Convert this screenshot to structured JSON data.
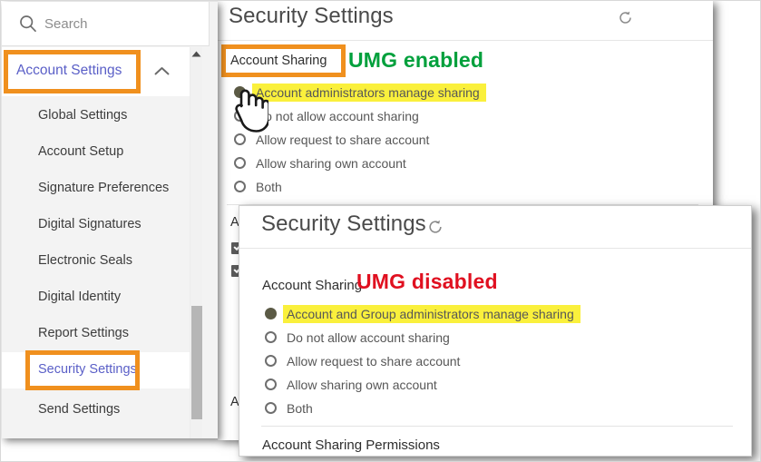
{
  "sidebar": {
    "search": {
      "placeholder": "Search",
      "icon": "search-icon"
    },
    "group": {
      "label": "Account Settings",
      "collapse_icon": "chevron-up-icon",
      "highlighted": true
    },
    "items": [
      {
        "label": "Global Settings",
        "active": false
      },
      {
        "label": "Account Setup",
        "active": false
      },
      {
        "label": "Signature Preferences",
        "active": false
      },
      {
        "label": "Digital Signatures",
        "active": false
      },
      {
        "label": "Electronic Seals",
        "active": false
      },
      {
        "label": "Digital Identity",
        "active": false
      },
      {
        "label": "Report Settings",
        "active": false
      },
      {
        "label": "Security Settings",
        "active": true
      },
      {
        "label": "Send Settings",
        "active": false
      }
    ],
    "scrollbar": {
      "up_arrow_icon": "triangle-up-icon"
    }
  },
  "back_window": {
    "title": "Security Settings",
    "refresh_icon": "refresh-icon",
    "section_label": "Account Sharing",
    "umg_tag": "UMG enabled",
    "umg_tag_color": "#00a03c",
    "options": [
      {
        "label": "Account administrators manage sharing",
        "selected": true,
        "highlighted": true
      },
      {
        "label": "Do not allow account sharing",
        "selected": false,
        "highlighted": false
      },
      {
        "label": "Allow request to share account",
        "selected": false,
        "highlighted": false
      },
      {
        "label": "Allow sharing own account",
        "selected": false,
        "highlighted": false
      },
      {
        "label": "Both",
        "selected": false,
        "highlighted": false
      }
    ],
    "obscured": {
      "label_top": "A",
      "label_bottom": "A",
      "checkbox_icon": "checkbox-checked-icon"
    },
    "cursor_icon": "hand-pointer-cursor"
  },
  "front_window": {
    "title": "Security Settings",
    "refresh_icon": "refresh-icon",
    "section_label": "Account Sharing",
    "umg_tag": "UMG disabled",
    "umg_tag_color": "#e01020",
    "options": [
      {
        "label": "Account and Group administrators manage sharing",
        "selected": true,
        "highlighted": true
      },
      {
        "label": "Do not allow account sharing",
        "selected": false,
        "highlighted": false
      },
      {
        "label": "Allow request to share account",
        "selected": false,
        "highlighted": false
      },
      {
        "label": "Allow sharing own account",
        "selected": false,
        "highlighted": false
      },
      {
        "label": "Both",
        "selected": false,
        "highlighted": false
      }
    ],
    "footer_section_label": "Account Sharing Permissions"
  },
  "annotations": {
    "highlight_color": "#faf03c",
    "callout_box_color": "#f0901e"
  }
}
